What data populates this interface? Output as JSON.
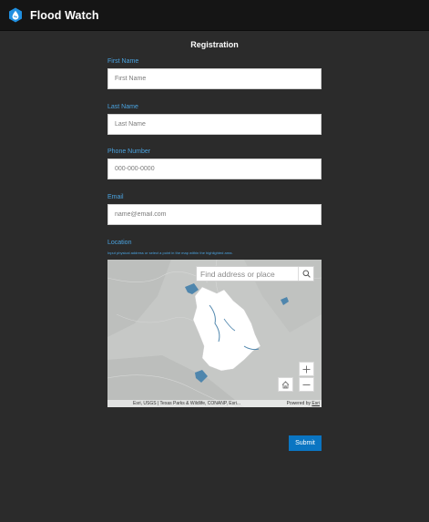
{
  "header": {
    "title": "Flood Watch",
    "logo_icon": "flood-watch-logo-icon"
  },
  "form": {
    "title": "Registration",
    "fields": {
      "first_name": {
        "label": "First Name",
        "placeholder": "First Name",
        "value": ""
      },
      "last_name": {
        "label": "Last Name",
        "placeholder": "Last Name",
        "value": ""
      },
      "phone": {
        "label": "Phone Number",
        "placeholder": "000-000-0000",
        "value": ""
      },
      "email": {
        "label": "Email",
        "placeholder": "name@email.com",
        "value": ""
      }
    },
    "location": {
      "label": "Location",
      "hint": "Input physical address or select a point in the map within the highlighted area."
    },
    "submit_label": "Submit"
  },
  "map": {
    "search_placeholder": "Find address or place",
    "attribution": "Esri, USGS | Texas Parks & Wildlife, CONANP, Esri...",
    "powered_by": "Powered by ",
    "powered_by_link": "Esri",
    "controls": [
      "search-icon",
      "zoom-in-icon",
      "zoom-out-icon",
      "home-icon"
    ]
  },
  "colors": {
    "background": "#2b2b2b",
    "header": "#151515",
    "accent_label": "#4aa3e0",
    "button": "#0a75c2",
    "highlight_area": "#ffffff",
    "water": "#4f86ad"
  }
}
